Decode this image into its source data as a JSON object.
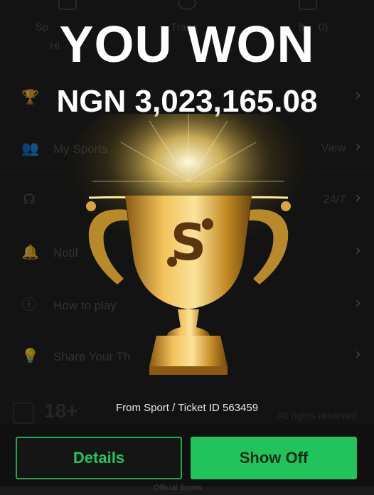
{
  "overlay": {
    "title": "YOU WON",
    "amount": "NGN 3,023,165.08",
    "ticket_info": "From Sport / Ticket ID 563459",
    "details_label": "Details",
    "show_off_label": "Show Off"
  },
  "background": {
    "tabs": [
      "Sp",
      "Hi",
      "Trans",
      "ft",
      "0)"
    ],
    "menu": [
      {
        "icon": "trophy-icon",
        "label": "",
        "value": ""
      },
      {
        "icon": "users-icon",
        "label": "My Sports",
        "value": "View"
      },
      {
        "icon": "headset-icon",
        "label": "",
        "value": "24/7"
      },
      {
        "icon": "bell-icon",
        "label": "Notif",
        "value": ""
      },
      {
        "icon": "info-icon",
        "label": "How to play",
        "value": ""
      },
      {
        "icon": "bulb-icon",
        "label": "Share Your Th",
        "value": ""
      }
    ],
    "age_badge": "18+",
    "rights": "All rights reserved",
    "footer": "Official Sports"
  },
  "colors": {
    "accent_green": "#21c45a",
    "gold": "#d4a02a"
  }
}
